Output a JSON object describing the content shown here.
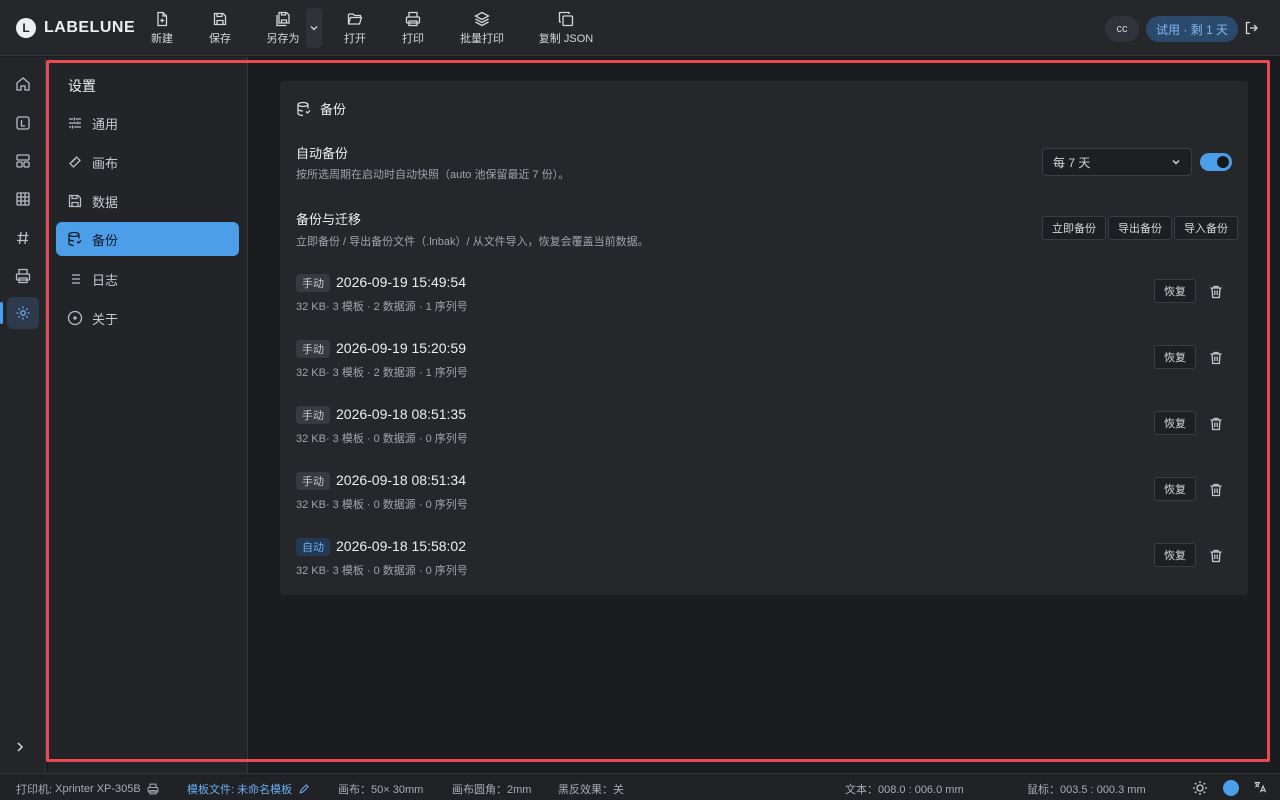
{
  "app": {
    "logo_mark": "L",
    "name": "LABELUNE"
  },
  "toolbar": {
    "new": "新建",
    "save": "保存",
    "save_as": "另存为",
    "open": "打开",
    "print": "打印",
    "batch_print": "批量打印",
    "copy_json": "复制 JSON"
  },
  "header": {
    "avatar": "cc",
    "trial": "试用 · 剩 1 天"
  },
  "settings_nav": {
    "title": "设置",
    "items": [
      {
        "label": "通用",
        "icon": "sliders-icon"
      },
      {
        "label": "画布",
        "icon": "ruler-icon"
      },
      {
        "label": "数据",
        "icon": "floppy-icon"
      },
      {
        "label": "备份",
        "icon": "database-backup-icon",
        "active": true
      },
      {
        "label": "日志",
        "icon": "list-icon"
      },
      {
        "label": "关于",
        "icon": "info-icon"
      }
    ]
  },
  "backup": {
    "section_title": "备份",
    "auto": {
      "title": "自动备份",
      "desc": "按所选周期在启动时自动快照（auto 池保留最近 7 份）。",
      "interval": "每 7 天",
      "enabled": true
    },
    "migrate": {
      "title": "备份与迁移",
      "desc": "立即备份 / 导出备份文件（.lnbak）/ 从文件导入，恢复会覆盖当前数据。",
      "backup_now": "立即备份",
      "export": "导出备份",
      "import": "导入备份"
    },
    "restore_label": "恢复",
    "entries": [
      {
        "tag": "手动",
        "time": "2026-09-19 15:49:54",
        "meta": "32 KB· 3 模板 · 2 数据源 · 1 序列号"
      },
      {
        "tag": "手动",
        "time": "2026-09-19 15:20:59",
        "meta": "32 KB· 3 模板 · 2 数据源 · 1 序列号"
      },
      {
        "tag": "手动",
        "time": "2026-09-18 08:51:35",
        "meta": "32 KB· 3 模板 · 0 数据源 · 0 序列号"
      },
      {
        "tag": "手动",
        "time": "2026-09-18 08:51:34",
        "meta": "32 KB· 3 模板 · 0 数据源 · 0 序列号"
      },
      {
        "tag": "自动",
        "time": "2026-09-18 15:58:02",
        "meta": "32 KB· 3 模板 · 0 数据源 · 0 序列号"
      }
    ]
  },
  "statusbar": {
    "printer_label": "打印机:",
    "printer": "Xprinter XP-305B",
    "template_label": "模板文件:",
    "template": "未命名模板",
    "canvas": "画布：50× 30mm",
    "corner": "画布圆角：2mm",
    "invert": "黑反效果：关",
    "text_pos": "文本：008.0 : 006.0 mm",
    "mouse_pos": "鼠标：003.5 : 000.3 mm"
  },
  "colors": {
    "accent": "#4c9ee9",
    "highlight": "#e84a52"
  }
}
